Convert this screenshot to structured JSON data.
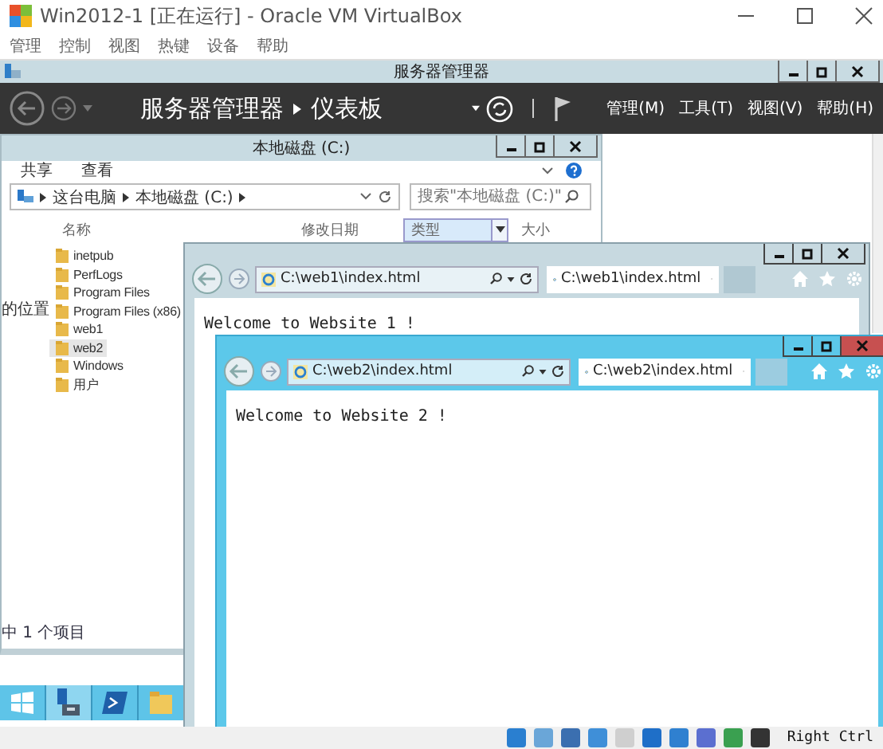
{
  "window": {
    "title": "Win2012-1 [正在运行] - Oracle VM VirtualBox"
  },
  "menu": [
    "管理",
    "控制",
    "视图",
    "热键",
    "设备",
    "帮助"
  ],
  "server_manager": {
    "title": "服务器管理器",
    "breadcrumb": [
      "服务器管理器",
      "仪表板"
    ],
    "menus": [
      "管理(M)",
      "工具(T)",
      "视图(V)",
      "帮助(H)"
    ]
  },
  "explorer": {
    "title": "本地磁盘 (C:)",
    "ribbon_tabs": [
      "共享",
      "查看"
    ],
    "path": [
      "这台电脑",
      "本地磁盘 (C:)"
    ],
    "search": {
      "placeholder": "搜索\"本地磁盘 (C:)\""
    },
    "columns": [
      {
        "label": "名称",
        "selected": false
      },
      {
        "label": "修改日期",
        "selected": false
      },
      {
        "label": "类型",
        "selected": true
      },
      {
        "label": "大小",
        "selected": false
      }
    ],
    "nav": [
      "的位置"
    ],
    "items": [
      {
        "name": "inetpub",
        "selected": false
      },
      {
        "name": "PerfLogs",
        "selected": false
      },
      {
        "name": "Program Files",
        "selected": false
      },
      {
        "name": "Program Files (x86)",
        "selected": false
      },
      {
        "name": "web1",
        "selected": false
      },
      {
        "name": "web2",
        "selected": true
      },
      {
        "name": "Windows",
        "selected": false
      },
      {
        "name": "用户",
        "selected": false
      }
    ],
    "status": "中 1 个项目"
  },
  "browsers": [
    {
      "address": "C:\\web1\\index.html",
      "tab": "C:\\web1\\index.html",
      "content": "Welcome to Website 1 !",
      "active": false
    },
    {
      "address": "C:\\web2\\index.html",
      "tab": "C:\\web2\\index.html",
      "content": "Welcome to Website 2 !",
      "active": true
    }
  ],
  "status_bar": {
    "host_key": "Right Ctrl"
  }
}
